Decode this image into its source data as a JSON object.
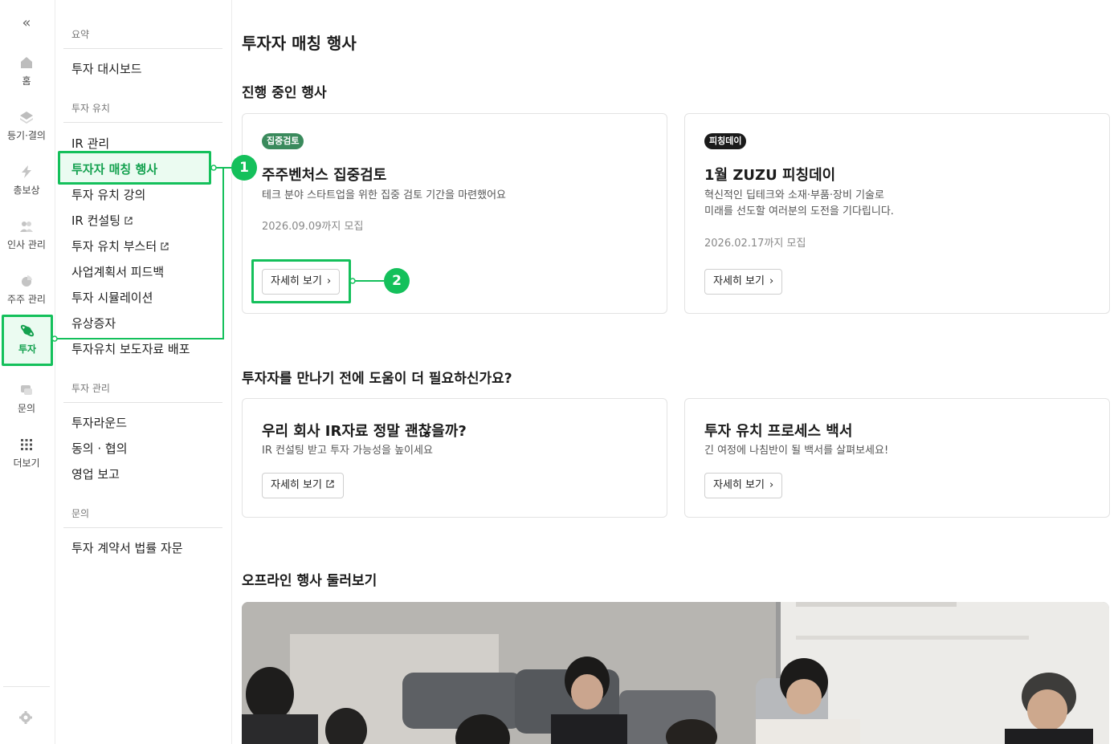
{
  "rail": {
    "collapse_icon": "chevrons-left-icon",
    "items": [
      {
        "label": "홈",
        "icon": "home-icon"
      },
      {
        "label": "등기·결의",
        "icon": "layers-icon"
      },
      {
        "label": "총보상",
        "icon": "bolt-icon"
      },
      {
        "label": "인사 관리",
        "icon": "people-icon"
      },
      {
        "label": "주주 관리",
        "icon": "pie-icon"
      },
      {
        "label": "투자",
        "icon": "planet-icon"
      },
      {
        "label": "문의",
        "icon": "chat-icon"
      },
      {
        "label": "더보기",
        "icon": "grid-icon"
      }
    ],
    "settings_icon": "gear-icon"
  },
  "subnav": {
    "sections": [
      {
        "title": "요약",
        "items": [
          "투자 대시보드"
        ]
      },
      {
        "title": "투자 유치",
        "items": [
          "IR 관리",
          "투자자 매칭 행사",
          "투자 유치 강의",
          "IR 컨설팅",
          "투자 유치 부스터",
          "사업계획서 피드백",
          "투자 시뮬레이션",
          "유상증자",
          "투자유치 보도자료 배포"
        ]
      },
      {
        "title": "투자 관리",
        "items": [
          "투자라운드",
          "동의 · 협의",
          "영업 보고"
        ]
      },
      {
        "title": "문의",
        "items": [
          "투자 계약서 법률 자문"
        ]
      }
    ],
    "active_item": "투자자 매칭 행사"
  },
  "callouts": [
    "1",
    "2"
  ],
  "main": {
    "page_title": "투자자 매칭 행사",
    "ongoing_title": "진행 중인 행사",
    "events": [
      {
        "tag": "집중검토",
        "title": "주주벤처스 집중검토",
        "desc": [
          "테크 분야 스타트업을 위한 집중 검토 기간을 마련했어요"
        ],
        "deadline": "2026.09.09까지 모집",
        "button": "자세히 보기"
      },
      {
        "tag": "피칭데이",
        "title": "1월 ZUZU 피칭데이",
        "desc": [
          "혁신적인 딥테크와 소재·부품·장비 기술로",
          "미래를 선도할 여러분의 도전을 기다립니다."
        ],
        "deadline": "2026.02.17까지 모집",
        "button": "자세히 보기"
      }
    ],
    "help_title": "투자자를 만나기 전에 도움이 더 필요하신가요?",
    "help_cards": [
      {
        "title": "우리 회사 IR자료 정말 괜찮을까?",
        "desc": "IR 컨설팅 받고 투자 가능성을 높이세요",
        "button": "자세히 보기"
      },
      {
        "title": "투자 유치 프로세스 백서",
        "desc": "긴 여정에 나침반이 될 백서를 살펴보세요!",
        "button": "자세히 보기"
      }
    ],
    "offline_title": "오프라인 행사 둘러보기"
  },
  "colors": {
    "accent": "#14c05b",
    "accent_text": "#14a14f",
    "tag_green": "#3a8a5c",
    "tag_black": "#1a1a1a"
  }
}
